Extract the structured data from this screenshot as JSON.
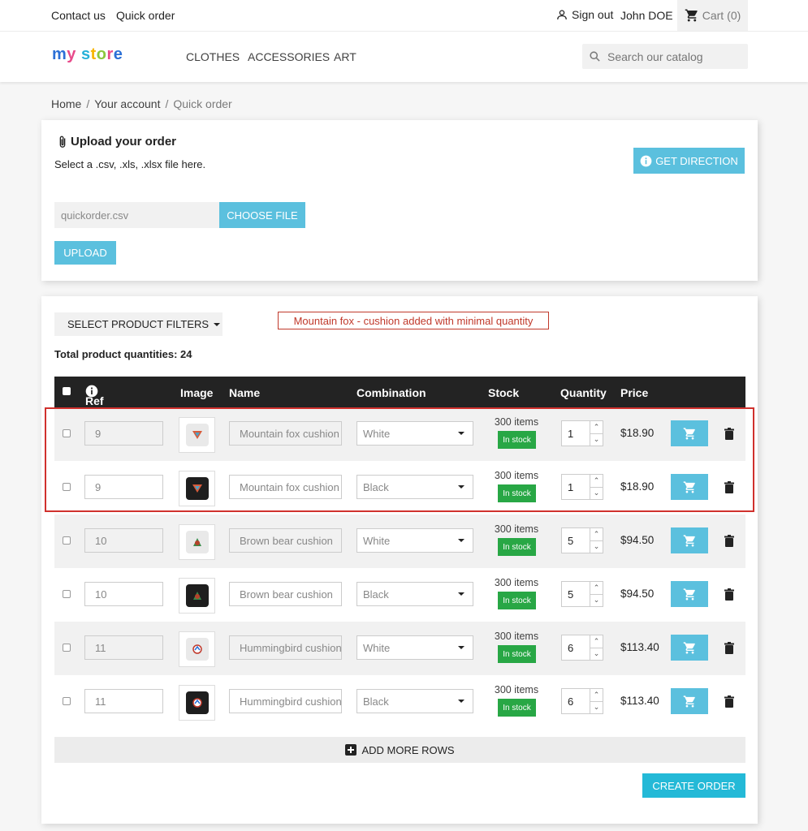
{
  "topbar": {
    "contact": "Contact us",
    "quick_order": "Quick order",
    "sign_out": "Sign out",
    "user": "John DOE",
    "cart": "Cart",
    "cart_count": "(0)"
  },
  "header": {
    "logo": {
      "m": "m",
      "y": "y",
      "s": "s",
      "t": "t",
      "o": "o",
      "r": "r",
      "e": "e"
    },
    "nav": [
      "CLOTHES",
      "ACCESSORIES",
      "ART"
    ],
    "search_placeholder": "Search our catalog"
  },
  "breadcrumb": [
    "Home",
    "Your account",
    "Quick order"
  ],
  "upload": {
    "title": "Upload your order",
    "description": "Select a .csv, .xls, .xlsx file here.",
    "get_direction": "GET DIRECTION",
    "file_name": "quickorder.csv",
    "choose_file": "CHOOSE FILE",
    "upload_button": "UPLOAD"
  },
  "order": {
    "filters_button": "SELECT PRODUCT FILTERS",
    "alert": "Mountain fox - cushion added with minimal quantity",
    "total_label": "Total product quantities: 24",
    "columns": [
      "Ref",
      "Image",
      "Name",
      "Combination",
      "Stock",
      "Quantity",
      "Price"
    ],
    "rows": [
      {
        "ref": "9",
        "name": "Mountain fox cushion",
        "combination": "White",
        "stock": "300 items",
        "badge": "In stock",
        "qty": "1",
        "price": "$18.90"
      },
      {
        "ref": "9",
        "name": "Mountain fox cushion",
        "combination": "Black",
        "stock": "300 items",
        "badge": "In stock",
        "qty": "1",
        "price": "$18.90"
      },
      {
        "ref": "10",
        "name": "Brown bear cushion",
        "combination": "White",
        "stock": "300 items",
        "badge": "In stock",
        "qty": "5",
        "price": "$94.50"
      },
      {
        "ref": "10",
        "name": "Brown bear cushion",
        "combination": "Black",
        "stock": "300 items",
        "badge": "In stock",
        "qty": "5",
        "price": "$94.50"
      },
      {
        "ref": "11",
        "name": "Hummingbird cushion",
        "combination": "White",
        "stock": "300 items",
        "badge": "In stock",
        "qty": "6",
        "price": "$113.40"
      },
      {
        "ref": "11",
        "name": "Hummingbird cushion",
        "combination": "Black",
        "stock": "300 items",
        "badge": "In stock",
        "qty": "6",
        "price": "$113.40"
      }
    ],
    "add_more_rows": "ADD MORE ROWS",
    "create_order": "CREATE ORDER"
  },
  "colors": {
    "accent": "#5bc0de",
    "dark_header": "#232323",
    "in_stock": "#28a745",
    "alert": "#c0392b"
  }
}
